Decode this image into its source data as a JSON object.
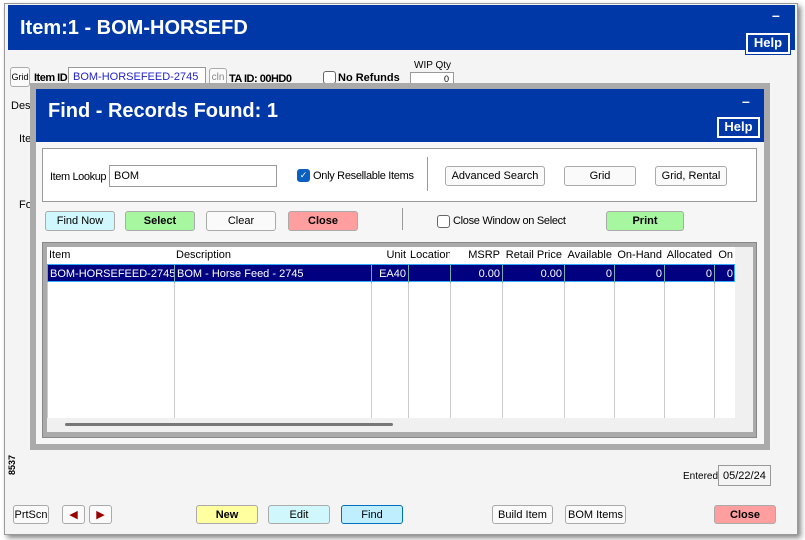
{
  "main_window": {
    "title": "Item:1 - BOM-HORSEFD",
    "minimize": "–",
    "help": "Help",
    "grid_btn": "Grid",
    "item_id_label": "Item ID",
    "item_id_value": "BOM-HORSEFEED-2745",
    "cln_btn": "cln",
    "ta_id": "TA ID: 00HD0",
    "no_refunds": "No Refunds",
    "no_refunds_checked": false,
    "wip_qty_label": "WIP Qty",
    "wip_qty_value": "0",
    "des_label": "Des",
    "ite_label": "Ite",
    "fo_label": "Fo",
    "side_number": "8537",
    "entered_label": "Entered",
    "entered_value": "05/22/24"
  },
  "toolbar": {
    "prtscn": "PrtScn",
    "new": "New",
    "edit": "Edit",
    "find": "Find",
    "build_item": "Build Item",
    "bom_items": "BOM Items",
    "close": "Close"
  },
  "dialog": {
    "title": "Find - Records Found: 1",
    "minimize": "–",
    "help": "Help",
    "lookup_label": "Item Lookup",
    "lookup_value": "BOM",
    "only_resellable": "Only Resellable Items",
    "only_resellable_checked": true,
    "advanced_search": "Advanced Search",
    "grid": "Grid",
    "grid_rental": "Grid, Rental",
    "find_now": "Find Now",
    "select": "Select",
    "clear": "Clear",
    "close": "Close",
    "close_on_select": "Close Window on Select",
    "close_on_select_checked": false,
    "print": "Print",
    "columns": [
      "Item",
      "Description",
      "Unit",
      "Location",
      "MSRP",
      "Retail Price",
      "Available",
      "On-Hand",
      "Allocated",
      "On"
    ],
    "rows": [
      [
        "BOM-HORSEFEED-2745",
        "BOM - Horse Feed - 2745",
        "EA40",
        "",
        "0.00",
        "0.00",
        "0",
        "0",
        "0",
        "0"
      ]
    ]
  },
  "colors": {
    "title_bar": "#0038a8",
    "new": "#ffffa0",
    "edit": "#d0f8fc",
    "find": "#bfefff",
    "close": "#ff9e9e",
    "select": "#a6f7a0",
    "selected_row": "#000080"
  }
}
